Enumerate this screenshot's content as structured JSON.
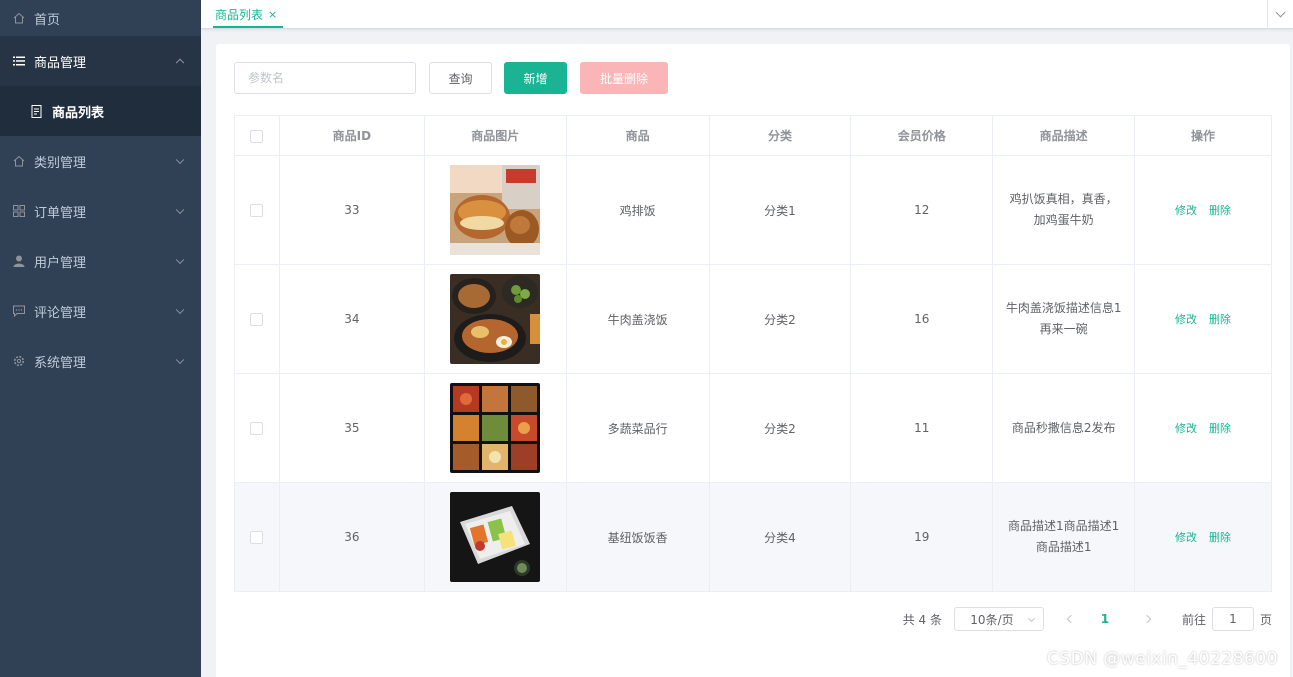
{
  "sidebar": {
    "home": {
      "label": "首页",
      "icon": "home-icon"
    },
    "items": [
      {
        "label": "商品管理",
        "icon": "list-icon",
        "expanded": true,
        "children": [
          {
            "label": "商品列表",
            "icon": "document-icon"
          }
        ]
      },
      {
        "label": "类别管理",
        "icon": "home-icon"
      },
      {
        "label": "订单管理",
        "icon": "grid-icon"
      },
      {
        "label": "用户管理",
        "icon": "user-icon"
      },
      {
        "label": "评论管理",
        "icon": "chat-icon"
      },
      {
        "label": "系统管理",
        "icon": "gear-icon"
      }
    ]
  },
  "tabs": [
    {
      "label": "商品列表",
      "close": "×",
      "active": true
    }
  ],
  "toolbar": {
    "search_placeholder": "参数名",
    "query_label": "查询",
    "add_label": "新增",
    "batch_delete_label": "批量删除"
  },
  "table": {
    "headers": [
      "商品ID",
      "商品图片",
      "商品",
      "分类",
      "会员价格",
      "商品描述",
      "操作"
    ],
    "rows": [
      {
        "id": "33",
        "name": "鸡排饭",
        "category": "分类1",
        "price": "12",
        "desc": [
          "鸡扒饭真相，真香，",
          "加鸡蛋牛奶"
        ],
        "image": "fried-chicken-food-photo"
      },
      {
        "id": "34",
        "name": "牛肉盖浇饭",
        "category": "分类2",
        "price": "16",
        "desc": [
          "牛肉盖浇饭描述信息1",
          "再来一碗"
        ],
        "image": "beef-rice-bowl-food-photo"
      },
      {
        "id": "35",
        "name": "多蔬菜品行",
        "category": "分类2",
        "price": "11",
        "desc": [
          "商品秒撒信息2发布"
        ],
        "image": "bento-box-food-photo"
      },
      {
        "id": "36",
        "name": "基纽饭饭香",
        "category": "分类4",
        "price": "19",
        "desc": [
          "商品描述1商品描述1",
          "商品描述1"
        ],
        "image": "lunchbox-food-photo"
      }
    ],
    "edit_label": "修改",
    "delete_label": "删除"
  },
  "pagination": {
    "total_text": "共 4 条",
    "page_size": "10条/页",
    "current_page": "1",
    "goto_prefix": "前往",
    "goto_value": "1",
    "goto_suffix": "页"
  },
  "watermark": "CSDN @weixin_40228600",
  "colors": {
    "accent": "#1ab394",
    "sidebar_bg": "#304156",
    "danger_light": "#fab6b6"
  }
}
